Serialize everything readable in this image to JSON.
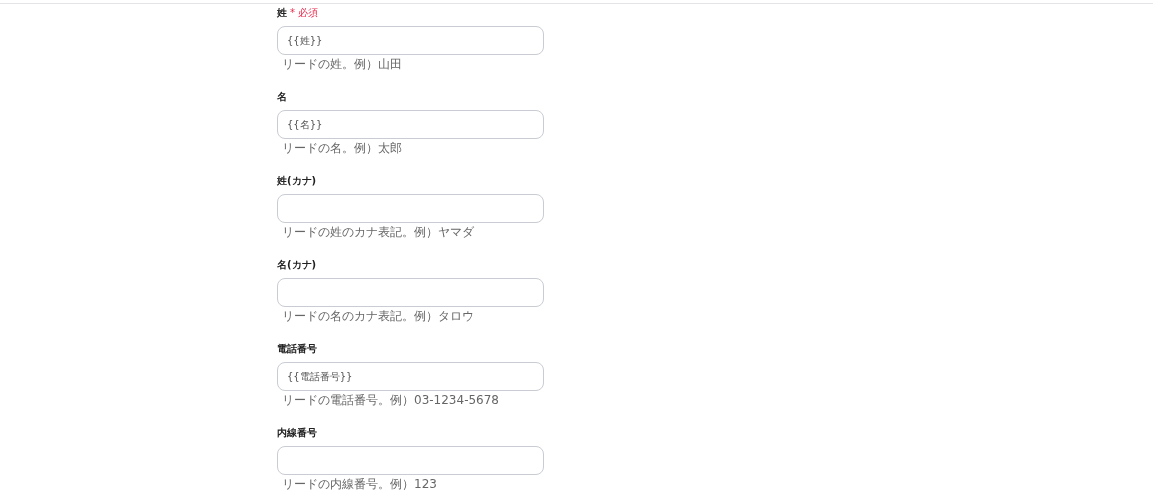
{
  "fields": [
    {
      "label": "姓",
      "required_mark": "*",
      "required_text": "必須",
      "value": "{{姓}}",
      "hint": "リードの姓。例）山田"
    },
    {
      "label": "名",
      "value": "{{名}}",
      "hint": "リードの名。例）太郎"
    },
    {
      "label": "姓(カナ)",
      "hint": "リードの姓のカナ表記。例）ヤマダ"
    },
    {
      "label": "名(カナ)",
      "hint": "リードの名のカナ表記。例）タロウ"
    },
    {
      "label": "電話番号",
      "value": "{{電話番号}}",
      "hint": "リードの電話番号。例）03-1234-5678"
    },
    {
      "label": "内線番号",
      "hint": "リードの内線番号。例）123"
    }
  ]
}
